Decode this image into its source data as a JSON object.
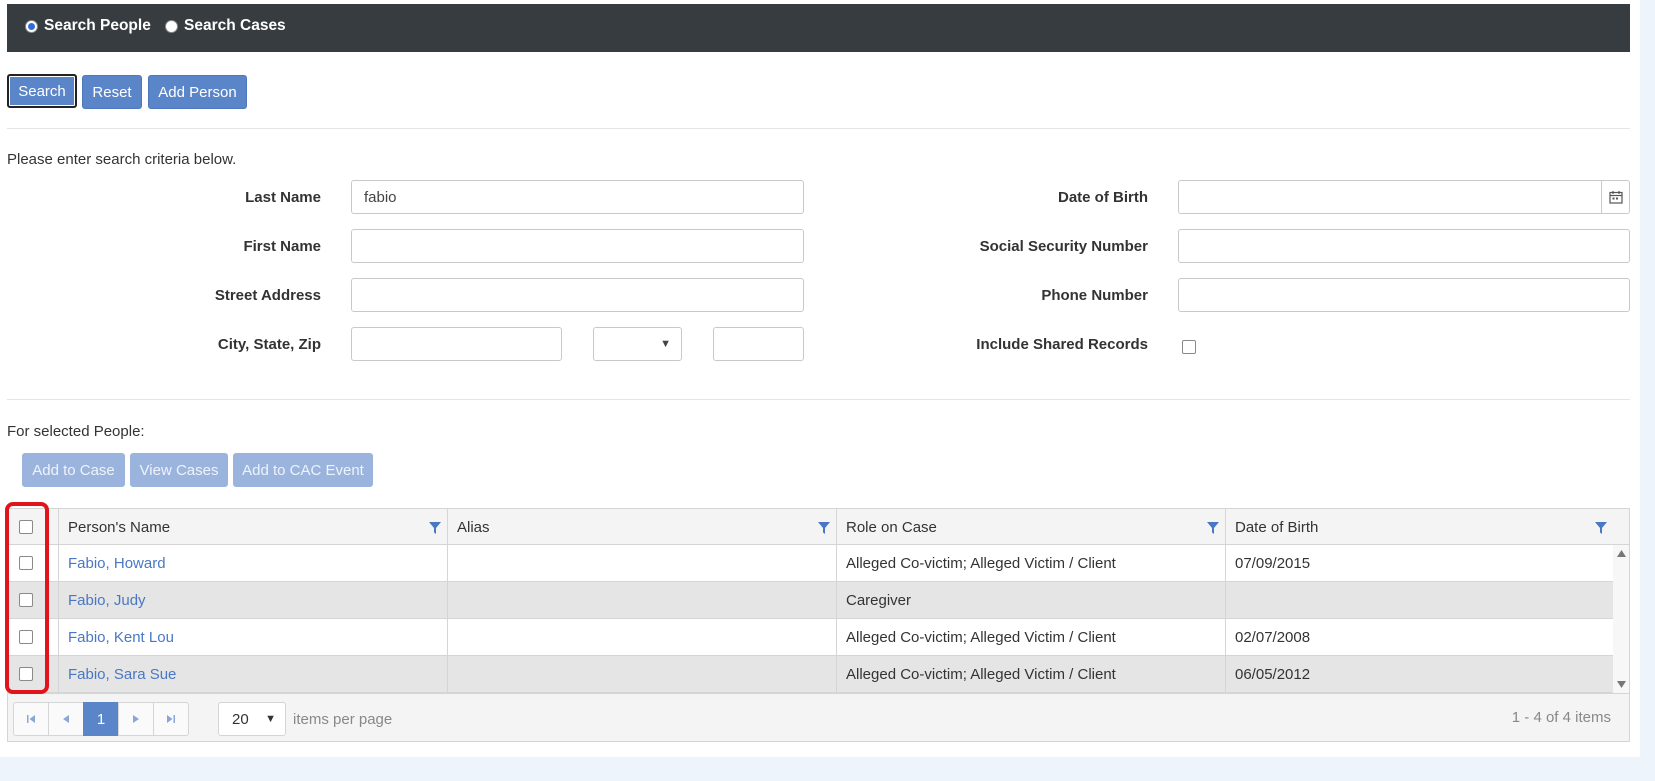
{
  "search_mode": {
    "options": [
      "Search People",
      "Search Cases"
    ],
    "selected": "Search People"
  },
  "toolbar": {
    "search_label": "Search",
    "reset_label": "Reset",
    "add_person_label": "Add Person"
  },
  "form": {
    "instructions": "Please enter search criteria below.",
    "last_name_label": "Last Name",
    "last_name_value": "fabio",
    "first_name_label": "First Name",
    "first_name_value": "",
    "street_label": "Street Address",
    "street_value": "",
    "city_state_zip_label": "City, State, Zip",
    "city_value": "",
    "state_value": "",
    "zip_value": "",
    "dob_label": "Date of Birth",
    "dob_value": "",
    "ssn_label": "Social Security Number",
    "ssn_value": "",
    "phone_label": "Phone Number",
    "phone_value": "",
    "shared_label": "Include Shared Records",
    "shared_checked": false
  },
  "selected_actions": {
    "label": "For selected People:",
    "add_to_case": "Add to Case",
    "view_cases": "View Cases",
    "add_to_cac_event": "Add to CAC Event"
  },
  "grid": {
    "columns": [
      "Person's Name",
      "Alias",
      "Role on Case",
      "Date of Birth"
    ],
    "rows": [
      {
        "name": "Fabio, Howard",
        "alias": "",
        "role": "Alleged Co-victim; Alleged Victim / Client",
        "dob": "07/09/2015"
      },
      {
        "name": "Fabio, Judy",
        "alias": "",
        "role": "Caregiver",
        "dob": ""
      },
      {
        "name": "Fabio, Kent Lou",
        "alias": "",
        "role": "Alleged Co-victim; Alleged Victim / Client",
        "dob": "02/07/2008"
      },
      {
        "name": "Fabio, Sara Sue",
        "alias": "",
        "role": "Alleged Co-victim; Alleged Victim / Client",
        "dob": "06/05/2012"
      }
    ]
  },
  "pager": {
    "current_page": "1",
    "page_size": "20",
    "items_per_page_label": "items per page",
    "summary": "1 - 4 of 4 items"
  },
  "colors": {
    "topbar": "#363c40",
    "button": "#5b85c9",
    "link": "#4a77c4",
    "highlight": "#e0151c"
  }
}
